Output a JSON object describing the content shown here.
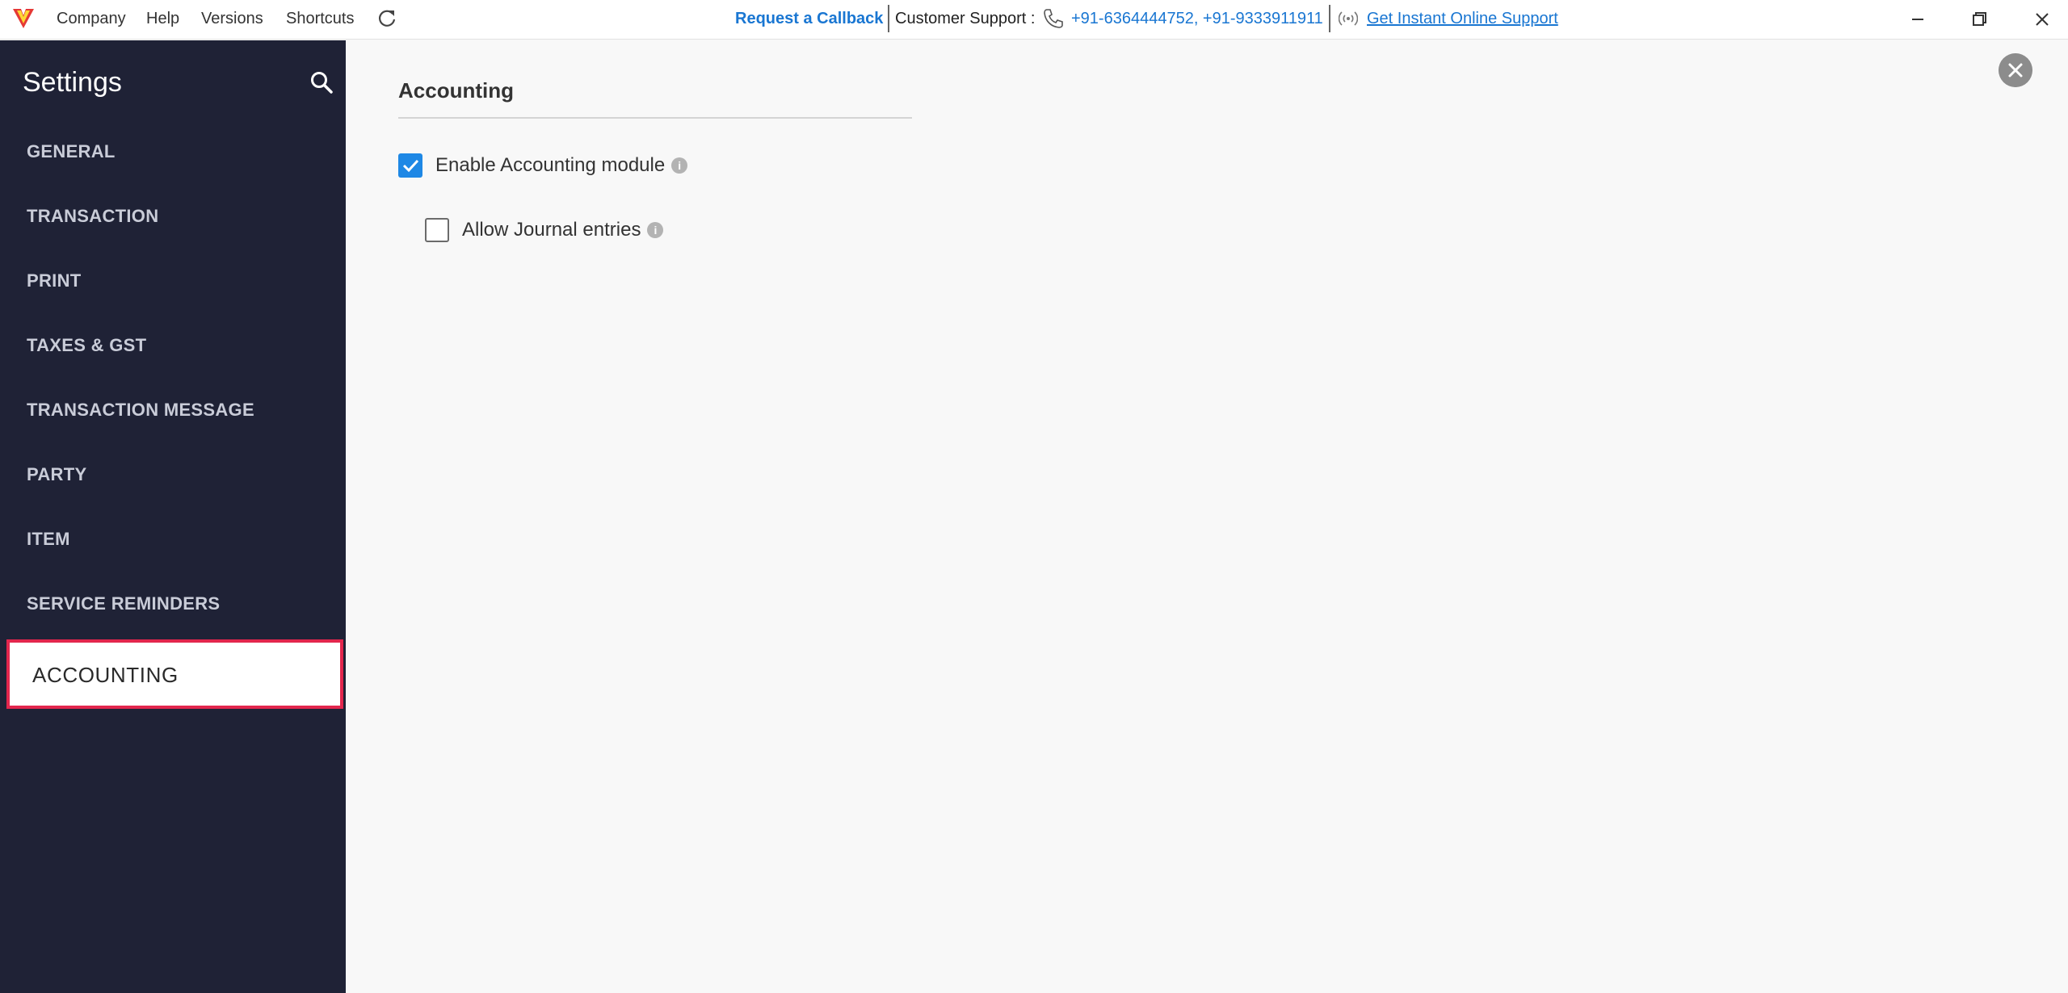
{
  "topbar": {
    "menu": [
      "Company",
      "Help",
      "Versions",
      "Shortcuts"
    ],
    "callback": "Request a Callback",
    "support_label": "Customer Support :",
    "phones": "+91-6364444752, +91-9333911911",
    "online_support": "Get Instant Online Support"
  },
  "sidebar": {
    "title": "Settings",
    "items": [
      "GENERAL",
      "TRANSACTION",
      "PRINT",
      "TAXES & GST",
      "TRANSACTION MESSAGE",
      "PARTY",
      "ITEM",
      "SERVICE REMINDERS"
    ],
    "active": "ACCOUNTING"
  },
  "main": {
    "section_title": "Accounting",
    "options": [
      {
        "label": "Enable Accounting module",
        "checked": true
      },
      {
        "label": "Allow Journal entries",
        "checked": false
      }
    ]
  },
  "colors": {
    "sidebar_bg": "#1f2236",
    "accent": "#1976d2",
    "active_border": "#e2264d",
    "checkbox_checked": "#1e88e5"
  }
}
